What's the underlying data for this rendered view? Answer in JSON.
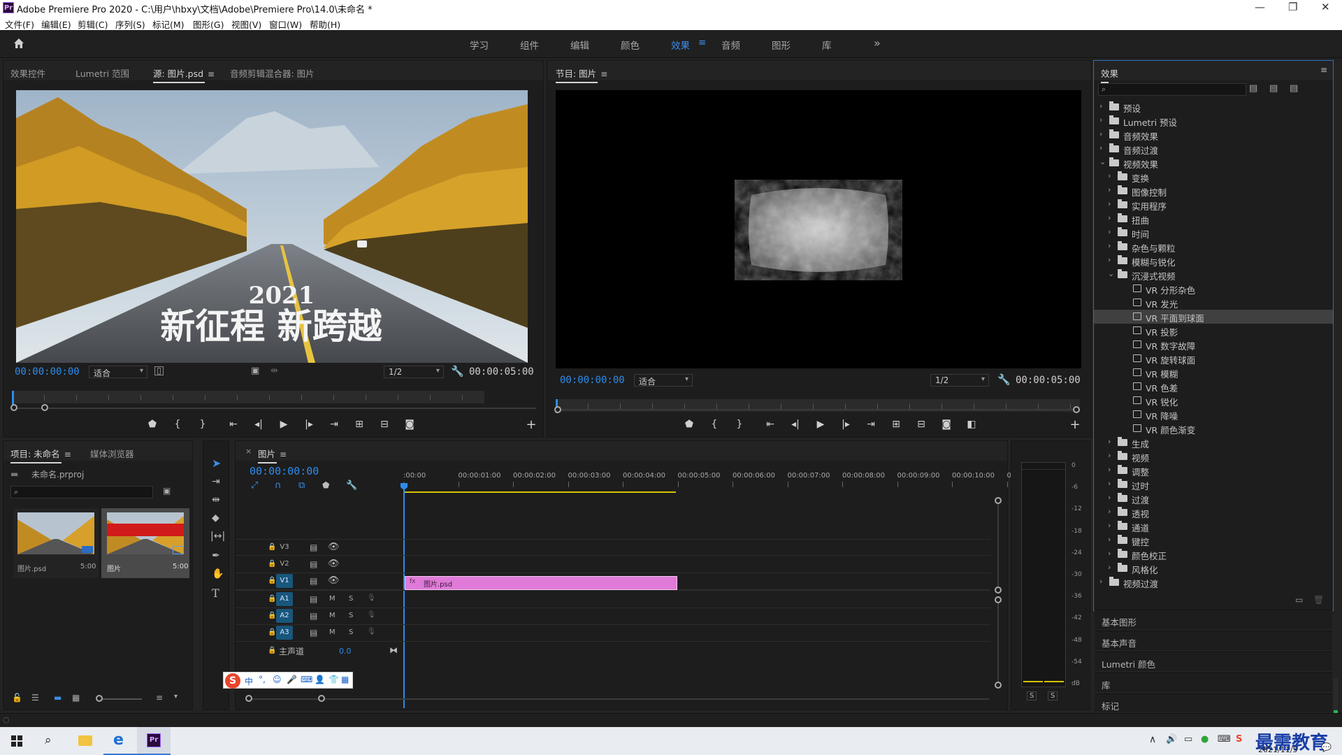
{
  "window": {
    "title": "Adobe Premiere Pro 2020 - C:\\用户\\hbxy\\文档\\Adobe\\Premiere Pro\\14.0\\未命名 *",
    "app_badge": "Pr"
  },
  "menu": [
    "文件(F)",
    "编辑(E)",
    "剪辑(C)",
    "序列(S)",
    "标记(M)",
    "图形(G)",
    "视图(V)",
    "窗口(W)",
    "帮助(H)"
  ],
  "workspaces": {
    "items": [
      "学习",
      "组件",
      "编辑",
      "颜色",
      "效果",
      "音频",
      "图形",
      "库"
    ],
    "active": "效果",
    "more": "»"
  },
  "source_panel": {
    "tabs": [
      "效果控件",
      "Lumetri 范围",
      "源: 图片.psd",
      "音频剪辑混合器: 图片"
    ],
    "active_tab": "源: 图片.psd",
    "timecode": "00:00:00:00",
    "fit": "适合",
    "resolution": "1/2",
    "duration": "00:00:05:00",
    "image_text_year": "2021",
    "image_text_slogan": "新征程 新跨越"
  },
  "program_panel": {
    "title": "节目: 图片",
    "timecode": "00:00:00:00",
    "fit": "适合",
    "resolution": "1/2",
    "duration": "00:00:05:00"
  },
  "effects_panel": {
    "title": "效果",
    "search_placeholder": "",
    "tree": [
      {
        "label": "预设",
        "level": 0,
        "type": "special",
        "expanded": false
      },
      {
        "label": "Lumetri 预设",
        "level": 0,
        "type": "special",
        "expanded": false
      },
      {
        "label": "音频效果",
        "level": 0,
        "type": "folder",
        "expanded": false
      },
      {
        "label": "音频过渡",
        "level": 0,
        "type": "folder",
        "expanded": false
      },
      {
        "label": "视频效果",
        "level": 0,
        "type": "folder",
        "expanded": true
      },
      {
        "label": "变换",
        "level": 1,
        "type": "folder",
        "expanded": false
      },
      {
        "label": "图像控制",
        "level": 1,
        "type": "folder",
        "expanded": false
      },
      {
        "label": "实用程序",
        "level": 1,
        "type": "folder",
        "expanded": false
      },
      {
        "label": "扭曲",
        "level": 1,
        "type": "folder",
        "expanded": false
      },
      {
        "label": "时间",
        "level": 1,
        "type": "folder",
        "expanded": false
      },
      {
        "label": "杂色与颗粒",
        "level": 1,
        "type": "folder",
        "expanded": false
      },
      {
        "label": "模糊与锐化",
        "level": 1,
        "type": "folder",
        "expanded": false
      },
      {
        "label": "沉浸式视频",
        "level": 1,
        "type": "folder",
        "expanded": true
      },
      {
        "label": "VR 分形杂色",
        "level": 2,
        "type": "effect"
      },
      {
        "label": "VR 发光",
        "level": 2,
        "type": "effect"
      },
      {
        "label": "VR 平面到球面",
        "level": 2,
        "type": "effect",
        "selected": true
      },
      {
        "label": "VR 投影",
        "level": 2,
        "type": "effect"
      },
      {
        "label": "VR 数字故障",
        "level": 2,
        "type": "effect"
      },
      {
        "label": "VR 旋转球面",
        "level": 2,
        "type": "effect"
      },
      {
        "label": "VR 模糊",
        "level": 2,
        "type": "effect"
      },
      {
        "label": "VR 色差",
        "level": 2,
        "type": "effect"
      },
      {
        "label": "VR 锐化",
        "level": 2,
        "type": "effect"
      },
      {
        "label": "VR 降噪",
        "level": 2,
        "type": "effect"
      },
      {
        "label": "VR 颜色渐变",
        "level": 2,
        "type": "effect"
      },
      {
        "label": "生成",
        "level": 1,
        "type": "folder",
        "expanded": false
      },
      {
        "label": "视频",
        "level": 1,
        "type": "folder",
        "expanded": false
      },
      {
        "label": "调整",
        "level": 1,
        "type": "folder",
        "expanded": false
      },
      {
        "label": "过时",
        "level": 1,
        "type": "folder",
        "expanded": false
      },
      {
        "label": "过渡",
        "level": 1,
        "type": "folder",
        "expanded": false
      },
      {
        "label": "透视",
        "level": 1,
        "type": "folder",
        "expanded": false
      },
      {
        "label": "通道",
        "level": 1,
        "type": "folder",
        "expanded": false
      },
      {
        "label": "键控",
        "level": 1,
        "type": "folder",
        "expanded": false
      },
      {
        "label": "颜色校正",
        "level": 1,
        "type": "folder",
        "expanded": false
      },
      {
        "label": "风格化",
        "level": 1,
        "type": "folder",
        "expanded": false
      },
      {
        "label": "视频过渡",
        "level": 0,
        "type": "folder",
        "expanded": false
      }
    ]
  },
  "side_panels": [
    "基本图形",
    "基本声音",
    "Lumetri 颜色",
    "库",
    "标记"
  ],
  "project_panel": {
    "tabs": [
      "项目: 未命名",
      "媒体浏览器"
    ],
    "project_file": "未命名.prproj",
    "items": [
      {
        "name": "图片.psd",
        "duration": "5:00"
      },
      {
        "name": "图片",
        "duration": "5:00"
      }
    ]
  },
  "timeline": {
    "sequence_name": "图片",
    "timecode": "00:00:00:00",
    "ruler_labels": [
      ":00:00",
      "00:00:01:00",
      "00:00:02:00",
      "00:00:03:00",
      "00:00:04:00",
      "00:00:05:00",
      "00:00:06:00",
      "00:00:07:00",
      "00:00:08:00",
      "00:00:09:00",
      "00:00:10:00",
      "0"
    ],
    "video_tracks": [
      "V3",
      "V2",
      "V1"
    ],
    "audio_tracks": [
      "A1",
      "A2",
      "A3"
    ],
    "master_label": "主声道",
    "master_value": "0.0",
    "mute_label": "M",
    "solo_label": "S",
    "clip_name": "图片.psd"
  },
  "audio_meter": {
    "scale": [
      "0",
      "-6",
      "-12",
      "-18",
      "-24",
      "-30",
      "-36",
      "-42",
      "-48",
      "-54",
      "dB"
    ],
    "solo_labels": [
      "S",
      "S"
    ]
  },
  "taskbar": {
    "date": "2021/11/5",
    "watermark": "最需教育"
  },
  "ime_toolbar": {
    "label": "中"
  },
  "colors": {
    "accent_blue": "#2d8ceb",
    "clip_pink": "#e07ad8",
    "selection_bg": "#404040",
    "timeline_work_area": "#d6c400"
  }
}
